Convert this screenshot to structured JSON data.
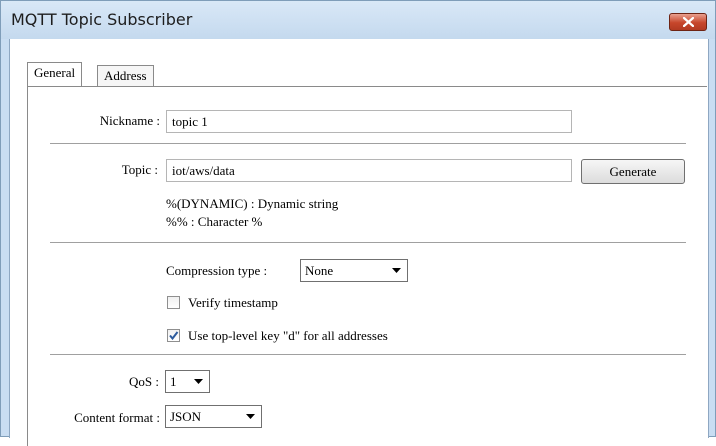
{
  "window": {
    "title": "MQTT Topic Subscriber"
  },
  "tabs": [
    {
      "label": "General",
      "active": true
    },
    {
      "label": "Address",
      "active": false
    }
  ],
  "form": {
    "nickname_label": "Nickname :",
    "nickname_value": "topic 1",
    "topic_label": "Topic :",
    "topic_value": "iot/aws/data",
    "generate_label": "Generate",
    "hint_dynamic": "%(DYNAMIC) : Dynamic string",
    "hint_percent": "%% : Character %",
    "compression_label": "Compression type :",
    "compression_value": "None",
    "verify_timestamp_label": "Verify timestamp",
    "verify_timestamp_checked": false,
    "top_level_key_label": "Use top-level key \"d\" for all addresses",
    "top_level_key_checked": true,
    "qos_label": "QoS :",
    "qos_value": "1",
    "content_format_label": "Content format :",
    "content_format_value": "JSON"
  },
  "colors": {
    "title_bar": "#c4d9ee",
    "close_button": "#c7462b",
    "check_mark": "#2c5a9c"
  }
}
